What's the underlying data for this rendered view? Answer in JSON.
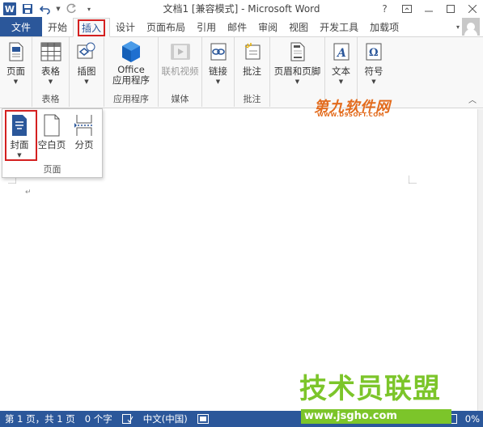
{
  "window": {
    "title": "文档1 [兼容模式] - Microsoft Word",
    "help": "?",
    "app_icon_letter": "W"
  },
  "tabs": {
    "file": "文件",
    "items": [
      "开始",
      "插入",
      "设计",
      "页面布局",
      "引用",
      "邮件",
      "审阅",
      "视图",
      "开发工具",
      "加载项"
    ],
    "active": "插入"
  },
  "ribbon": {
    "groups": [
      {
        "label": "",
        "buttons": [
          {
            "label": "页面",
            "icon": "page-icon"
          }
        ]
      },
      {
        "label": "表格",
        "buttons": [
          {
            "label": "表格",
            "icon": "table-icon"
          }
        ]
      },
      {
        "label": "",
        "buttons": [
          {
            "label": "插图",
            "icon": "illustration-icon"
          }
        ]
      },
      {
        "label": "应用程序",
        "buttons": [
          {
            "label": "Office\n应用程序",
            "icon": "office-icon"
          }
        ]
      },
      {
        "label": "媒体",
        "buttons": [
          {
            "label": "联机视频",
            "icon": "video-icon",
            "disabled": true
          }
        ]
      },
      {
        "label": "",
        "buttons": [
          {
            "label": "链接",
            "icon": "link-icon"
          }
        ]
      },
      {
        "label": "批注",
        "buttons": [
          {
            "label": "批注",
            "icon": "comment-icon"
          }
        ]
      },
      {
        "label": "",
        "buttons": [
          {
            "label": "页眉和页脚",
            "icon": "header-footer-icon"
          }
        ]
      },
      {
        "label": "",
        "buttons": [
          {
            "label": "文本",
            "icon": "text-icon"
          }
        ]
      },
      {
        "label": "",
        "buttons": [
          {
            "label": "符号",
            "icon": "symbol-icon"
          }
        ]
      }
    ]
  },
  "dropdown": {
    "group_label": "页面",
    "buttons": [
      {
        "label": "封面",
        "icon": "cover-page-icon",
        "highlighted": true
      },
      {
        "label": "空白页",
        "icon": "blank-page-icon"
      },
      {
        "label": "分页",
        "icon": "page-break-icon"
      }
    ]
  },
  "watermarks": {
    "top_logo": "第九软件网",
    "top_logo_sub": "WWW.D9SOFT.COM",
    "bottom_logo": "技术员联盟",
    "bottom_logo_sub": "www.jsgho.com"
  },
  "statusbar": {
    "page": "第 1 页，共 1 页",
    "words": "0 个字",
    "language": "中文(中国)",
    "zoom": "0%"
  },
  "colors": {
    "accent": "#2b579a",
    "highlight": "#d42020",
    "watermark_orange": "#e36c1e",
    "watermark_green": "#7cc52a"
  }
}
